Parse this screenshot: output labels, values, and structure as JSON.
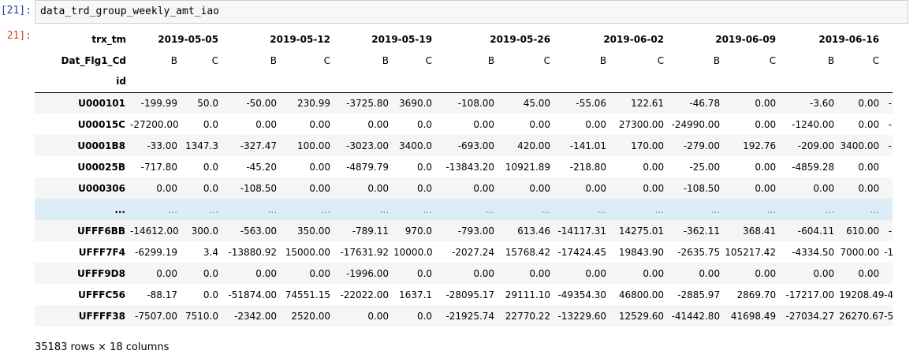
{
  "cell": {
    "in_prompt": "[21]:",
    "out_prompt": "21]:",
    "code": "data_trd_group_weekly_amt_iao"
  },
  "table": {
    "index_name_row1": "trx_tm",
    "index_name_row2": "Dat_Flg1_Cd",
    "index_name_row3": "id",
    "dates": [
      "2019-05-05",
      "2019-05-12",
      "2019-05-19",
      "2019-05-26",
      "2019-06-02",
      "2019-06-09",
      "2019-06-16"
    ],
    "subcols": [
      "B",
      "C",
      "B",
      "C",
      "B",
      "C",
      "B",
      "C",
      "B",
      "C",
      "B",
      "C",
      "B",
      "C"
    ],
    "rows": [
      {
        "id": "U000101",
        "values": [
          "-199.99",
          "50.0",
          "-50.00",
          "230.99",
          "-3725.80",
          "3690.0",
          "-108.00",
          "45.00",
          "-55.06",
          "122.61",
          "-46.78",
          "0.00",
          "-3.60",
          "0.00",
          "-"
        ]
      },
      {
        "id": "U00015C",
        "values": [
          "-27200.00",
          "0.0",
          "0.00",
          "0.00",
          "0.00",
          "0.0",
          "0.00",
          "0.00",
          "0.00",
          "27300.00",
          "-24990.00",
          "0.00",
          "-1240.00",
          "0.00",
          "-"
        ]
      },
      {
        "id": "U0001B8",
        "values": [
          "-33.00",
          "1347.3",
          "-327.47",
          "100.00",
          "-3023.00",
          "3400.0",
          "-693.00",
          "420.00",
          "-141.01",
          "170.00",
          "-279.00",
          "192.76",
          "-209.00",
          "3400.00",
          "-"
        ]
      },
      {
        "id": "U00025B",
        "values": [
          "-717.80",
          "0.0",
          "-45.20",
          "0.00",
          "-4879.79",
          "0.0",
          "-13843.20",
          "10921.89",
          "-218.80",
          "0.00",
          "-25.00",
          "0.00",
          "-4859.28",
          "0.00",
          ""
        ]
      },
      {
        "id": "U000306",
        "values": [
          "0.00",
          "0.0",
          "-108.50",
          "0.00",
          "0.00",
          "0.0",
          "0.00",
          "0.00",
          "0.00",
          "0.00",
          "-108.50",
          "0.00",
          "0.00",
          "0.00",
          ""
        ]
      },
      {
        "id": "...",
        "values": [
          "...",
          "...",
          "...",
          "...",
          "...",
          "...",
          "...",
          "...",
          "...",
          "...",
          "...",
          "...",
          "...",
          "...",
          ""
        ],
        "ellipsis": true
      },
      {
        "id": "UFFF6BB",
        "values": [
          "-14612.00",
          "300.0",
          "-563.00",
          "350.00",
          "-789.11",
          "970.0",
          "-793.00",
          "613.46",
          "-14117.31",
          "14275.01",
          "-362.11",
          "368.41",
          "-604.11",
          "610.00",
          "-"
        ]
      },
      {
        "id": "UFFF7F4",
        "values": [
          "-6299.19",
          "3.4",
          "-13880.92",
          "15000.00",
          "-17631.92",
          "10000.0",
          "-2027.24",
          "15768.42",
          "-17424.45",
          "19843.90",
          "-2635.75",
          "105217.42",
          "-4334.50",
          "7000.00",
          "-1"
        ]
      },
      {
        "id": "UFFF9D8",
        "values": [
          "0.00",
          "0.0",
          "0.00",
          "0.00",
          "-1996.00",
          "0.0",
          "0.00",
          "0.00",
          "0.00",
          "0.00",
          "0.00",
          "0.00",
          "0.00",
          "0.00",
          ""
        ]
      },
      {
        "id": "UFFFC56",
        "values": [
          "-88.17",
          "0.0",
          "-51874.00",
          "74551.15",
          "-22022.00",
          "1637.1",
          "-28095.17",
          "29111.10",
          "-49354.30",
          "46800.00",
          "-2885.97",
          "2869.70",
          "-17217.00",
          "19208.49",
          "-4"
        ]
      },
      {
        "id": "UFFFF38",
        "values": [
          "-7507.00",
          "7510.0",
          "-2342.00",
          "2520.00",
          "0.00",
          "0.0",
          "-21925.74",
          "22770.22",
          "-13229.60",
          "12529.60",
          "-41442.80",
          "41698.49",
          "-27034.27",
          "26270.67",
          "-5"
        ]
      }
    ],
    "hover_row_index": 5
  },
  "summary": "35183 rows × 18 columns"
}
